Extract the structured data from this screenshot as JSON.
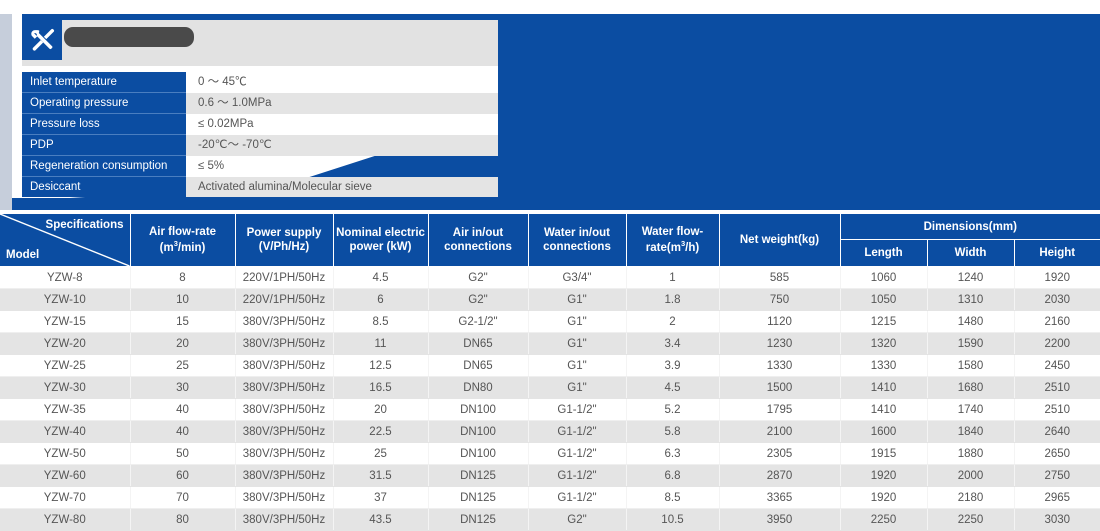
{
  "banner": {
    "title_redacted": "",
    "icon": "tools-icon",
    "accent_blue": "#0b4da2",
    "strip_color": "#c6cedb"
  },
  "spec_panel": {
    "rows": [
      {
        "label": "Inlet temperature",
        "value": "0 ～ 45℃"
      },
      {
        "label": "Operating pressure",
        "value": "0.6 ～ 1.0MPa"
      },
      {
        "label": "Pressure loss",
        "value": "≤ 0.02MPa"
      },
      {
        "label": "PDP",
        "value": "-20℃～ -70℃"
      },
      {
        "label": "Regeneration consumption",
        "value": "≤ 5%"
      },
      {
        "label": "Desiccant",
        "value": "Activated alumina/Molecular sieve"
      }
    ]
  },
  "table": {
    "corner": {
      "spec_label": "Specifications",
      "model_label": "Model"
    },
    "headers": {
      "air_flow": "Air flow-rate",
      "air_flow_unit_pre": "(m",
      "air_flow_unit_sup": "3",
      "air_flow_unit_post": "/min)",
      "power_supply": "Power supply",
      "power_supply_unit": "(V/Ph/Hz)",
      "nominal_power_1": "Nominal electric",
      "nominal_power_2": "power (kW)",
      "air_conn_1": "Air in/out",
      "air_conn_2": "connections",
      "water_conn_1": "Water in/out",
      "water_conn_2": "connections",
      "water_flow_1": "Water flow-",
      "water_flow_2_pre": "rate(m",
      "water_flow_2_sup": "3",
      "water_flow_2_post": "/h)",
      "net_weight": "Net weight(kg)",
      "dimensions": "Dimensions(mm)",
      "length": "Length",
      "width": "Width",
      "height": "Height"
    },
    "rows": [
      {
        "model": "YZW-8",
        "air_flow": "8",
        "power_supply": "220V/1PH/50Hz",
        "power_kw": "4.5",
        "air_conn": "G2\"",
        "water_conn": "G3/4\"",
        "water_flow": "1",
        "net_weight": "585",
        "length": "1060",
        "width": "1240",
        "height": "1920"
      },
      {
        "model": "YZW-10",
        "air_flow": "10",
        "power_supply": "220V/1PH/50Hz",
        "power_kw": "6",
        "air_conn": "G2\"",
        "water_conn": "G1\"",
        "water_flow": "1.8",
        "net_weight": "750",
        "length": "1050",
        "width": "1310",
        "height": "2030"
      },
      {
        "model": "YZW-15",
        "air_flow": "15",
        "power_supply": "380V/3PH/50Hz",
        "power_kw": "8.5",
        "air_conn": "G2-1/2\"",
        "water_conn": "G1\"",
        "water_flow": "2",
        "net_weight": "1120",
        "length": "1215",
        "width": "1480",
        "height": "2160"
      },
      {
        "model": "YZW-20",
        "air_flow": "20",
        "power_supply": "380V/3PH/50Hz",
        "power_kw": "11",
        "air_conn": "DN65",
        "water_conn": "G1\"",
        "water_flow": "3.4",
        "net_weight": "1230",
        "length": "1320",
        "width": "1590",
        "height": "2200"
      },
      {
        "model": "YZW-25",
        "air_flow": "25",
        "power_supply": "380V/3PH/50Hz",
        "power_kw": "12.5",
        "air_conn": "DN65",
        "water_conn": "G1\"",
        "water_flow": "3.9",
        "net_weight": "1330",
        "length": "1330",
        "width": "1580",
        "height": "2450"
      },
      {
        "model": "YZW-30",
        "air_flow": "30",
        "power_supply": "380V/3PH/50Hz",
        "power_kw": "16.5",
        "air_conn": "DN80",
        "water_conn": "G1\"",
        "water_flow": "4.5",
        "net_weight": "1500",
        "length": "1410",
        "width": "1680",
        "height": "2510"
      },
      {
        "model": "YZW-35",
        "air_flow": "40",
        "power_supply": "380V/3PH/50Hz",
        "power_kw": "20",
        "air_conn": "DN100",
        "water_conn": "G1-1/2\"",
        "water_flow": "5.2",
        "net_weight": "1795",
        "length": "1410",
        "width": "1740",
        "height": "2510"
      },
      {
        "model": "YZW-40",
        "air_flow": "40",
        "power_supply": "380V/3PH/50Hz",
        "power_kw": "22.5",
        "air_conn": "DN100",
        "water_conn": "G1-1/2\"",
        "water_flow": "5.8",
        "net_weight": "2100",
        "length": "1600",
        "width": "1840",
        "height": "2640"
      },
      {
        "model": "YZW-50",
        "air_flow": "50",
        "power_supply": "380V/3PH/50Hz",
        "power_kw": "25",
        "air_conn": "DN100",
        "water_conn": "G1-1/2\"",
        "water_flow": "6.3",
        "net_weight": "2305",
        "length": "1915",
        "width": "1880",
        "height": "2650"
      },
      {
        "model": "YZW-60",
        "air_flow": "60",
        "power_supply": "380V/3PH/50Hz",
        "power_kw": "31.5",
        "air_conn": "DN125",
        "water_conn": "G1-1/2\"",
        "water_flow": "6.8",
        "net_weight": "2870",
        "length": "1920",
        "width": "2000",
        "height": "2750"
      },
      {
        "model": "YZW-70",
        "air_flow": "70",
        "power_supply": "380V/3PH/50Hz",
        "power_kw": "37",
        "air_conn": "DN125",
        "water_conn": "G1-1/2\"",
        "water_flow": "8.5",
        "net_weight": "3365",
        "length": "1920",
        "width": "2180",
        "height": "2965"
      },
      {
        "model": "YZW-80",
        "air_flow": "80",
        "power_supply": "380V/3PH/50Hz",
        "power_kw": "43.5",
        "air_conn": "DN125",
        "water_conn": "G2\"",
        "water_flow": "10.5",
        "net_weight": "3950",
        "length": "2250",
        "width": "2250",
        "height": "3030"
      }
    ]
  }
}
